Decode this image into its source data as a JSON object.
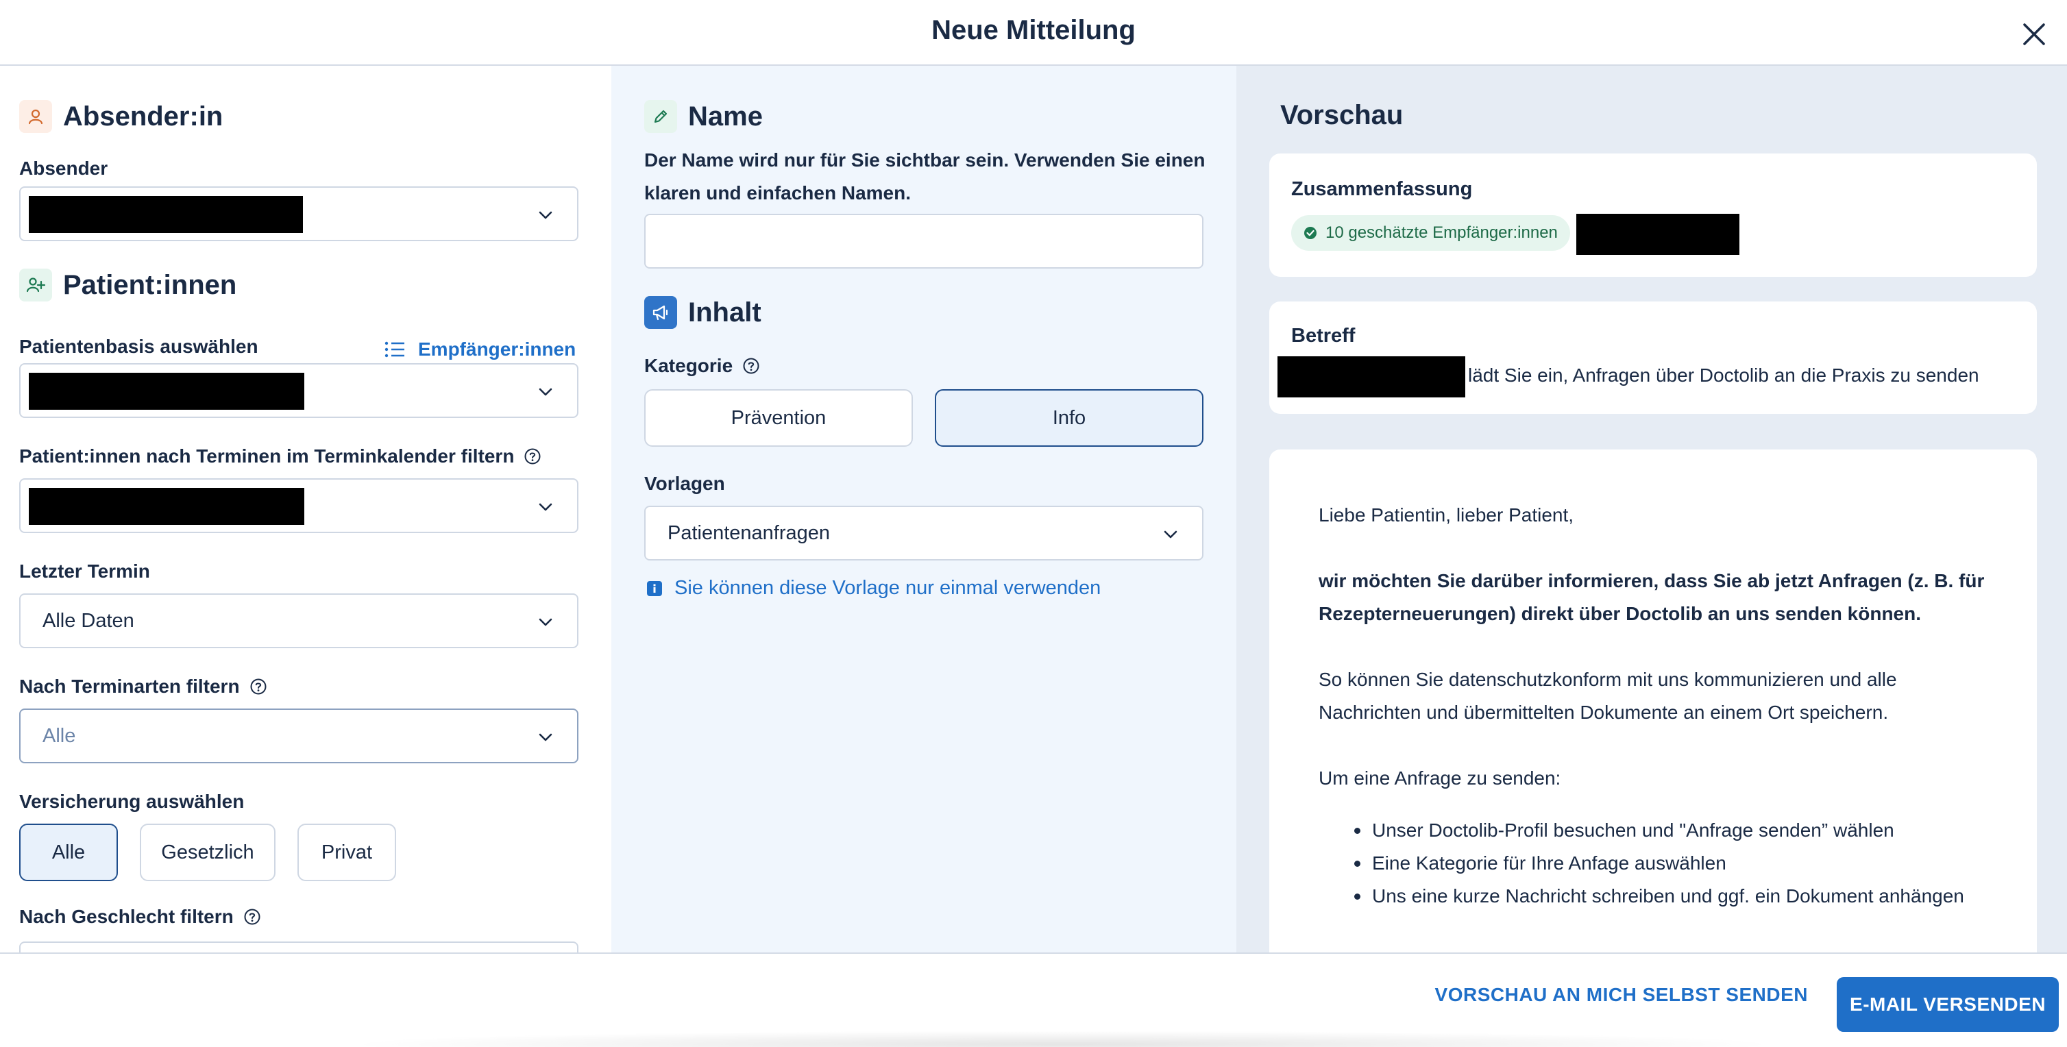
{
  "header": {
    "title": "Neue Mitteilung"
  },
  "sender_section": {
    "title": "Absender:in",
    "sender_label": "Absender"
  },
  "patients_section": {
    "title": "Patient:innen",
    "recipients_link": "Empfänger:innen",
    "base_label": "Patientenbasis auswählen",
    "filter_appointments_label": "Patient:innen nach Terminen im Terminkalender filtern",
    "last_appointment_label": "Letzter Termin",
    "last_appointment_value": "Alle Daten",
    "appointment_types_label": "Nach Terminarten filtern",
    "appointment_types_value": "Alle",
    "insurance_label": "Versicherung auswählen",
    "insurance_options": [
      "Alle",
      "Gesetzlich",
      "Privat"
    ],
    "insurance_selected": "Alle",
    "gender_label": "Nach Geschlecht filtern"
  },
  "name_section": {
    "title": "Name",
    "description_line1": "Der Name wird nur für Sie sichtbar sein. Verwenden Sie einen",
    "description_line2": "klaren und einfachen Namen.",
    "value": ""
  },
  "content_section": {
    "title": "Inhalt",
    "category_label": "Kategorie",
    "categories": [
      "Prävention",
      "Info"
    ],
    "category_selected": "Info",
    "templates_label": "Vorlagen",
    "template_value": "Patientenanfragen",
    "template_info": "Sie können diese Vorlage nur einmal verwenden"
  },
  "preview": {
    "title": "Vorschau",
    "summary_title": "Zusammenfassung",
    "recipients_badge": "10 geschätzte Empfänger:innen",
    "subject_title": "Betreff",
    "subject_text": "lädt Sie ein, Anfragen über Doctolib an die Praxis zu senden",
    "mail": {
      "greeting": "Liebe Patientin, lieber Patient,",
      "bold_line1": "wir möchten Sie darüber informieren, dass Sie ab jetzt Anfragen (z. B. für",
      "bold_line2": "Rezepterneuerungen) direkt über Doctolib an uns senden können.",
      "para_line1": "So können Sie datenschutzkonform mit uns kommunizieren und alle",
      "para_line2": "Nachrichten und übermittelten Dokumente an einem Ort speichern.",
      "steps_intro": "Um eine Anfrage zu senden:",
      "steps": [
        "Unser Doctolib-Profil besuchen und \"Anfrage senden” wählen",
        "Eine Kategorie für Ihre Anfage auswählen",
        "Uns eine kurze Nachricht schreiben und ggf. ein Dokument anhängen"
      ]
    }
  },
  "footer": {
    "preview_button": "VORSCHAU AN MICH SELBST SENDEN",
    "send_button": "E-MAIL VERSENDEN"
  },
  "colors": {
    "accent": "#1f6fc8",
    "text": "#1a2a44",
    "mid_panel": "#f0f6fd",
    "right_panel": "#e6ecf4",
    "badge_bg": "#e6f5ee",
    "badge_text": "#1d6a47"
  }
}
